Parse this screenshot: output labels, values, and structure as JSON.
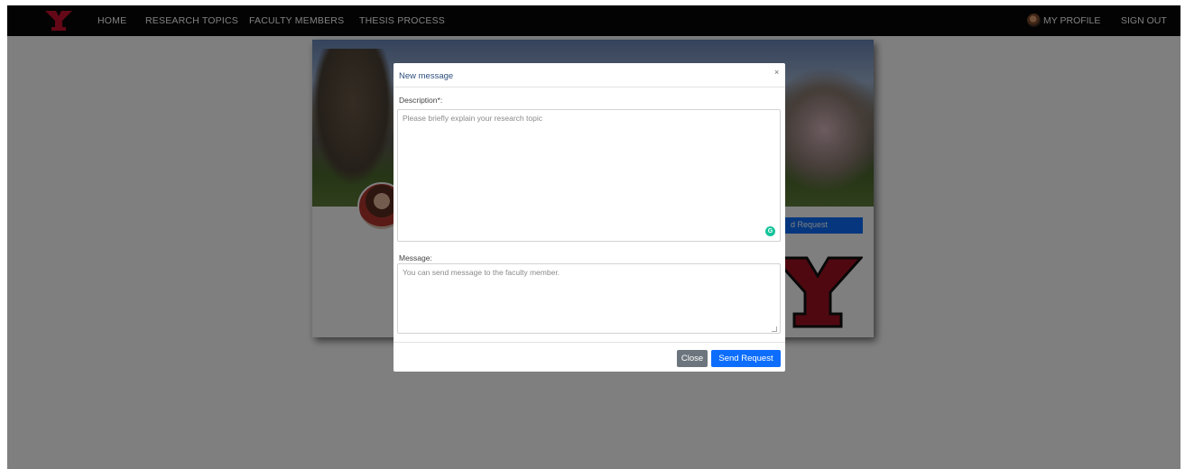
{
  "navbar": {
    "logo_alt": "Y",
    "links": [
      "HOME",
      "RESEARCH TOPICS",
      "FACULTY MEMBERS",
      "THESIS PROCESS"
    ],
    "profile_label": "MY PROFILE",
    "signout_label": "SIGN OUT"
  },
  "background_page": {
    "request_button_label": "d Request"
  },
  "modal": {
    "title": "New message",
    "close_symbol": "×",
    "description_label": "Description*:",
    "description_placeholder": "Please briefly explain your research topic",
    "description_value": "",
    "message_label": "Message:",
    "message_placeholder": "You can send message to the faculty member.",
    "message_value": "",
    "close_button": "Close",
    "send_button": "Send Request"
  },
  "colors": {
    "navbar_bg": "#070707",
    "brand_red": "#c8102e",
    "primary_blue": "#0d6efd",
    "secondary_gray": "#6c757d",
    "overlay": "rgba(0,0,0,0.5)"
  },
  "icons": [
    "ysu-logo-icon",
    "profile-avatar-icon",
    "grammarly-icon",
    "close-icon",
    "resize-grip-icon"
  ]
}
